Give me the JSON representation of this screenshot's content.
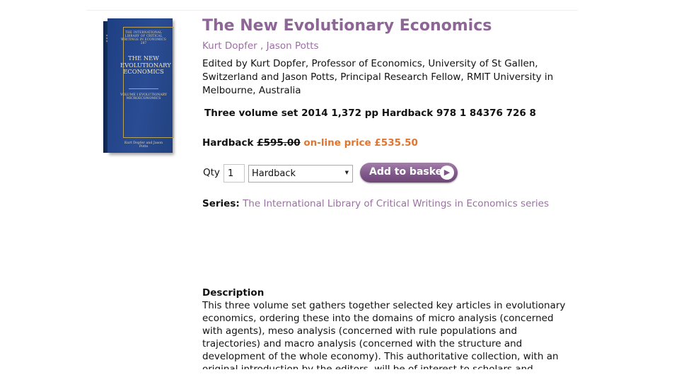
{
  "book_cover": {
    "series_text": "THE INTERNATIONAL LIBRARY OF CRITICAL WRITINGS IN ECONOMICS 287",
    "title_text": "THE NEW EVOLUTIONARY ECONOMICS",
    "volume_text": "VOLUME I EVOLUTIONARY MICROECONOMICS",
    "author_text": "Kurt Dopfer and Jason Potts",
    "cover_color": "#22427f"
  },
  "product": {
    "title": "The New Evolutionary Economics",
    "author1": "Kurt Dopfer",
    "author_sep": " , ",
    "author2": "Jason Potts",
    "editors": "Edited by Kurt Dopfer, Professor of Economics, University of St Gallen, Switzerland and Jason Potts, Principal Research Fellow, RMIT University in Melbourne, Australia",
    "volume_info": "Three volume set 2014 1,372 pp Hardback 978 1 84376 726 8",
    "price_label": "Hardback",
    "old_price": "£595.00",
    "online_price": "on-line price £535.50"
  },
  "purchase": {
    "qty_label": "Qty",
    "qty_value": "1",
    "format_selected": "Hardback",
    "button_label": "Add to basket",
    "button_color": "#7e5687"
  },
  "series": {
    "label": "Series:",
    "link_text": "The International Library of Critical Writings in Economics series"
  },
  "description": {
    "heading": "Description",
    "text": "This three volume set gathers together selected key articles in evolutionary economics, ordering these into the domains of micro analysis (concerned with agents), meso analysis (concerned with rule populations and trajectories) and macro analysis (concerned with the structure and development of the whole economy). This authoritative collection, with an original introduction by the editors, will be of interest to scholars and researchers seeking to understand"
  },
  "colors": {
    "title": "#8d6596",
    "link": "#9b6fa3",
    "online_price": "#e07530"
  }
}
